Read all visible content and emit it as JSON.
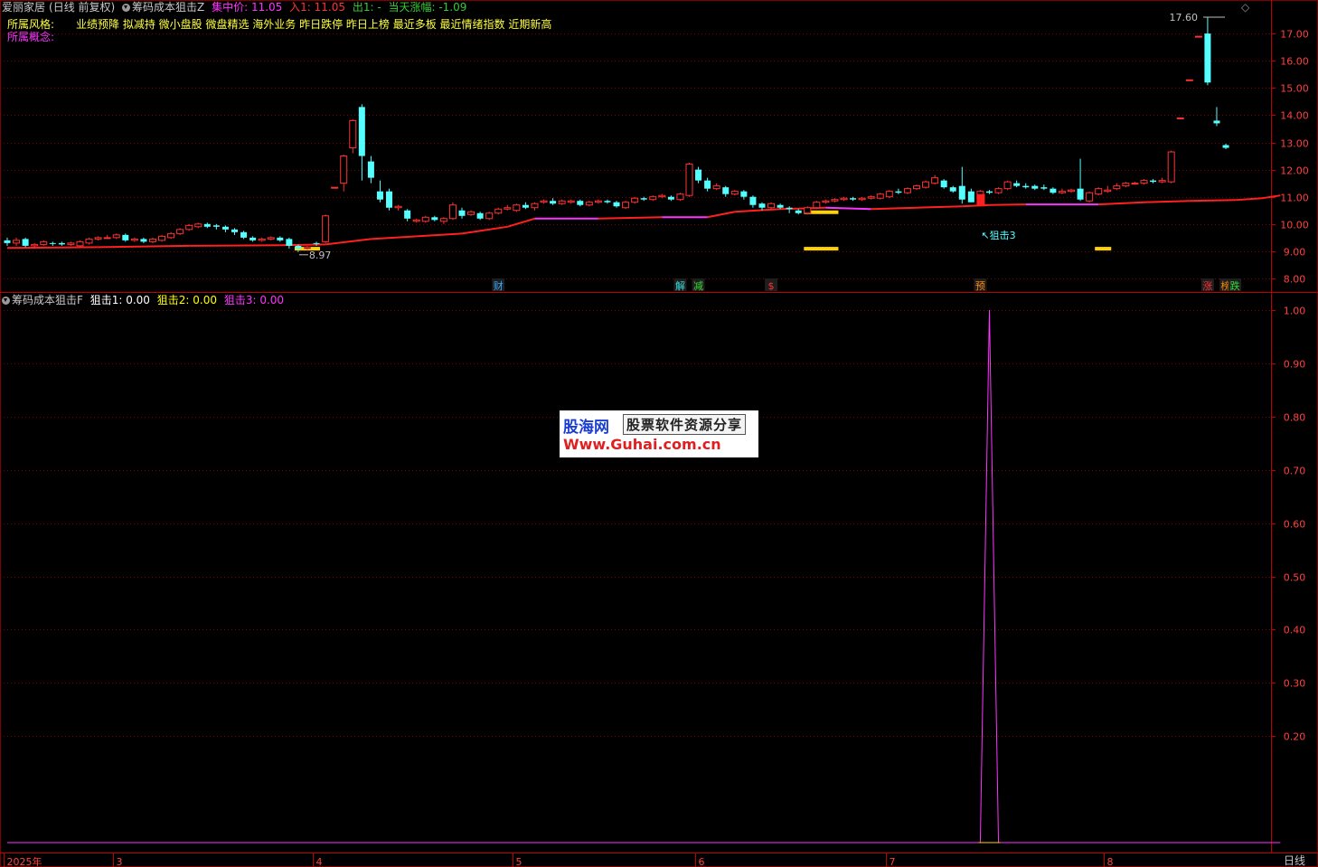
{
  "header": {
    "stock": "爱丽家居",
    "period": "(日线 前复权)",
    "indicator_main": "筹码成本狙击Z",
    "ind_items": [
      {
        "label": "集中价: 11.05",
        "color": "#ff33ff"
      },
      {
        "label": "入1: 11.05",
        "color": "#ff3333"
      },
      {
        "label": "出1: -",
        "color": "#33cc33"
      },
      {
        "label": "当天涨幅: -1.09",
        "color": "#33cc33"
      }
    ],
    "style_label": "所属风格:",
    "style_tags": "业绩预降 拟减持 微小盘股 微盘精选 海外业务 昨日跌停 昨日上榜 最近多板 最近情绪指数 近期新高",
    "concept_label": "所属概念:",
    "diamond": "◇"
  },
  "sub_header": {
    "indicator_sub": "筹码成本狙击F",
    "items": [
      {
        "label": "狙击1: 0.00",
        "color": "#ffffff"
      },
      {
        "label": "狙击2: 0.00",
        "color": "#ffff00"
      },
      {
        "label": "狙击3: 0.00",
        "color": "#ff33ff"
      }
    ]
  },
  "watermark": {
    "brand": "股海网",
    "slogan": "股票软件资源分享",
    "url": "Www.Guhai.com.cn"
  },
  "annotations": {
    "high_label": "17.60",
    "low_label": "8.97",
    "signal_label": "狙击3",
    "markers": [
      {
        "text": "财",
        "color": "#33aaff",
        "index": 54
      },
      {
        "text": "解",
        "color": "#33dddd",
        "index": 74
      },
      {
        "text": "减",
        "color": "#33dd33",
        "index": 76
      },
      {
        "text": "$",
        "color": "#ff3333",
        "index": 84
      },
      {
        "text": "预",
        "color": "#ff8800",
        "index": 107
      },
      {
        "text": "涨",
        "color": "#ff3333",
        "index": 132
      },
      {
        "text": "榜",
        "color": "#ff8800",
        "index": 134
      },
      {
        "text": "跌",
        "color": "#33dd33",
        "index": 135
      }
    ]
  },
  "footer": {
    "period_label": "日线"
  },
  "colors": {
    "up": "#ff3232",
    "down": "#54ffff",
    "cost_line_red": "#ff2020",
    "cost_line_magenta": "#ff33ff",
    "grid": "#800000",
    "axis_text": "#ff4040",
    "signal": "#ff33ff",
    "zone_yellow": "#ffd200"
  },
  "chart_data": [
    {
      "type": "candlestick",
      "title": "筹码成本狙击Z",
      "y_ticks": [
        "8.00",
        "9.00",
        "10.00",
        "11.00",
        "12.00",
        "13.00",
        "14.00",
        "15.00",
        "16.00",
        "17.00"
      ],
      "ylim": [
        7.7,
        17.9
      ],
      "x_ticks": [
        {
          "label": "2025年",
          "index": 0
        },
        {
          "label": "3",
          "index": 12
        },
        {
          "label": "4",
          "index": 34
        },
        {
          "label": "5",
          "index": 56
        },
        {
          "label": "6",
          "index": 76
        },
        {
          "label": "7",
          "index": 97
        },
        {
          "label": "8",
          "index": 121
        }
      ],
      "candles": [
        [
          9.4,
          9.3,
          9.5,
          9.2
        ],
        [
          9.3,
          9.4,
          9.5,
          9.2
        ],
        [
          9.45,
          9.2,
          9.5,
          9.15
        ],
        [
          9.2,
          9.25,
          9.3,
          9.1
        ],
        [
          9.25,
          9.35,
          9.4,
          9.2
        ],
        [
          9.3,
          9.28,
          9.35,
          9.2
        ],
        [
          9.3,
          9.25,
          9.35,
          9.2
        ],
        [
          9.25,
          9.3,
          9.35,
          9.2
        ],
        [
          9.2,
          9.35,
          9.4,
          9.15
        ],
        [
          9.3,
          9.45,
          9.5,
          9.25
        ],
        [
          9.45,
          9.5,
          9.55,
          9.4
        ],
        [
          9.5,
          9.5,
          9.6,
          9.45
        ],
        [
          9.5,
          9.6,
          9.65,
          9.45
        ],
        [
          9.6,
          9.4,
          9.65,
          9.35
        ],
        [
          9.4,
          9.45,
          9.5,
          9.35
        ],
        [
          9.45,
          9.35,
          9.5,
          9.3
        ],
        [
          9.35,
          9.45,
          9.5,
          9.3
        ],
        [
          9.4,
          9.55,
          9.6,
          9.35
        ],
        [
          9.5,
          9.65,
          9.7,
          9.45
        ],
        [
          9.65,
          9.8,
          9.85,
          9.6
        ],
        [
          9.8,
          9.95,
          10.0,
          9.75
        ],
        [
          9.9,
          10.0,
          10.05,
          9.85
        ],
        [
          10.0,
          9.9,
          10.05,
          9.85
        ],
        [
          9.95,
          9.9,
          10.0,
          9.8
        ],
        [
          9.9,
          9.8,
          9.95,
          9.7
        ],
        [
          9.8,
          9.7,
          9.85,
          9.6
        ],
        [
          9.7,
          9.5,
          9.75,
          9.45
        ],
        [
          9.5,
          9.4,
          9.55,
          9.35
        ],
        [
          9.4,
          9.45,
          9.5,
          9.35
        ],
        [
          9.45,
          9.5,
          9.55,
          9.4
        ],
        [
          9.5,
          9.4,
          9.55,
          9.35
        ],
        [
          9.45,
          9.2,
          9.5,
          9.1
        ],
        [
          9.2,
          9.1,
          9.25,
          8.97
        ],
        [
          9.1,
          9.15,
          9.2,
          9.05
        ],
        [
          9.3,
          9.28,
          9.35,
          9.2
        ],
        [
          9.35,
          10.3,
          10.35,
          9.3
        ],
        [
          11.35,
          11.35,
          11.35,
          11.35
        ],
        [
          11.5,
          12.5,
          12.55,
          11.2
        ],
        [
          12.8,
          13.8,
          13.85,
          12.6
        ],
        [
          14.3,
          12.5,
          14.4,
          11.6
        ],
        [
          12.3,
          11.7,
          12.5,
          11.5
        ],
        [
          11.2,
          10.9,
          11.6,
          10.8
        ],
        [
          11.2,
          10.6,
          11.3,
          10.5
        ],
        [
          10.6,
          10.65,
          10.7,
          10.5
        ],
        [
          10.5,
          10.2,
          10.55,
          10.1
        ],
        [
          10.1,
          10.15,
          10.2,
          10.05
        ],
        [
          10.1,
          10.25,
          10.3,
          10.05
        ],
        [
          10.25,
          10.15,
          10.3,
          10.1
        ],
        [
          10.1,
          10.2,
          10.25,
          10.0
        ],
        [
          10.2,
          10.7,
          10.8,
          10.15
        ],
        [
          10.5,
          10.3,
          10.6,
          10.2
        ],
        [
          10.35,
          10.45,
          10.5,
          10.3
        ],
        [
          10.4,
          10.2,
          10.45,
          10.15
        ],
        [
          10.2,
          10.4,
          10.45,
          10.15
        ],
        [
          10.4,
          10.55,
          10.6,
          10.35
        ],
        [
          10.55,
          10.6,
          10.7,
          10.5
        ],
        [
          10.5,
          10.7,
          10.75,
          10.45
        ],
        [
          10.7,
          10.6,
          10.8,
          10.55
        ],
        [
          10.6,
          10.75,
          10.8,
          10.5
        ],
        [
          10.8,
          10.85,
          10.9,
          10.75
        ],
        [
          10.85,
          10.75,
          10.95,
          10.7
        ],
        [
          10.75,
          10.85,
          10.9,
          10.7
        ],
        [
          10.8,
          10.85,
          10.9,
          10.75
        ],
        [
          10.85,
          10.7,
          10.9,
          10.65
        ],
        [
          10.7,
          10.8,
          10.85,
          10.65
        ],
        [
          10.8,
          10.85,
          10.9,
          10.75
        ],
        [
          10.85,
          10.8,
          10.9,
          10.75
        ],
        [
          10.8,
          10.65,
          10.85,
          10.6
        ],
        [
          10.6,
          10.8,
          10.85,
          10.55
        ],
        [
          10.8,
          10.95,
          11.0,
          10.75
        ],
        [
          10.95,
          10.9,
          11.0,
          10.85
        ],
        [
          10.9,
          11.0,
          11.05,
          10.85
        ],
        [
          11.0,
          11.05,
          11.1,
          10.95
        ],
        [
          11.0,
          10.9,
          11.05,
          10.85
        ],
        [
          10.9,
          11.1,
          11.15,
          10.85
        ],
        [
          11.05,
          12.2,
          12.25,
          11.0
        ],
        [
          12.0,
          11.6,
          12.1,
          11.5
        ],
        [
          11.6,
          11.3,
          11.7,
          11.2
        ],
        [
          11.3,
          11.4,
          11.5,
          11.25
        ],
        [
          11.35,
          11.1,
          11.4,
          11.0
        ],
        [
          11.1,
          11.2,
          11.25,
          11.05
        ],
        [
          11.2,
          11.0,
          11.25,
          10.9
        ],
        [
          11.0,
          10.7,
          11.05,
          10.6
        ],
        [
          10.75,
          10.6,
          10.8,
          10.5
        ],
        [
          10.6,
          10.75,
          10.8,
          10.55
        ],
        [
          10.7,
          10.6,
          10.75,
          10.55
        ],
        [
          10.6,
          10.55,
          10.65,
          10.4
        ],
        [
          10.5,
          10.4,
          10.55,
          10.35
        ],
        [
          10.4,
          10.6,
          10.65,
          10.35
        ],
        [
          10.6,
          10.8,
          10.85,
          10.55
        ],
        [
          10.8,
          10.85,
          10.9,
          10.75
        ],
        [
          10.85,
          10.9,
          10.95,
          10.8
        ],
        [
          10.9,
          10.95,
          11.0,
          10.85
        ],
        [
          10.95,
          10.9,
          11.0,
          10.85
        ],
        [
          10.9,
          10.95,
          11.0,
          10.85
        ],
        [
          10.95,
          11.0,
          11.05,
          10.9
        ],
        [
          10.95,
          11.1,
          11.15,
          10.9
        ],
        [
          11.0,
          11.2,
          11.25,
          10.95
        ],
        [
          11.2,
          11.15,
          11.3,
          11.1
        ],
        [
          11.15,
          11.3,
          11.35,
          11.1
        ],
        [
          11.3,
          11.4,
          11.45,
          11.25
        ],
        [
          11.35,
          11.55,
          11.6,
          11.3
        ],
        [
          11.5,
          11.7,
          11.8,
          11.45
        ],
        [
          11.6,
          11.35,
          11.65,
          11.3
        ],
        [
          11.35,
          11.2,
          11.4,
          11.15
        ],
        [
          11.4,
          10.9,
          12.1,
          10.75
        ],
        [
          11.2,
          10.8,
          11.3,
          10.8
        ],
        [
          11.0,
          11.2,
          11.25,
          10.95
        ],
        [
          11.2,
          11.15,
          11.25,
          11.1
        ],
        [
          11.15,
          11.3,
          11.35,
          11.1
        ],
        [
          11.3,
          11.55,
          11.6,
          11.25
        ],
        [
          11.5,
          11.4,
          11.6,
          11.35
        ],
        [
          11.4,
          11.35,
          11.5,
          11.3
        ],
        [
          11.4,
          11.3,
          11.45,
          11.25
        ],
        [
          11.35,
          11.3,
          11.45,
          11.25
        ],
        [
          11.3,
          11.15,
          11.35,
          11.1
        ],
        [
          11.15,
          11.2,
          11.3,
          11.1
        ],
        [
          11.2,
          11.25,
          11.3,
          11.15
        ],
        [
          11.3,
          10.9,
          12.4,
          10.85
        ],
        [
          10.85,
          11.15,
          11.2,
          10.8
        ],
        [
          11.1,
          11.3,
          11.35,
          11.05
        ],
        [
          11.2,
          11.25,
          11.4,
          11.15
        ],
        [
          11.3,
          11.4,
          11.5,
          11.25
        ],
        [
          11.4,
          11.5,
          11.55,
          11.35
        ],
        [
          11.5,
          11.5,
          11.55,
          11.45
        ],
        [
          11.5,
          11.6,
          11.65,
          11.45
        ],
        [
          11.6,
          11.55,
          11.65,
          11.5
        ],
        [
          11.55,
          11.6,
          11.7,
          11.5
        ],
        [
          11.55,
          12.65,
          12.7,
          11.5
        ],
        [
          13.9,
          13.9,
          13.9,
          13.9
        ],
        [
          15.3,
          15.3,
          15.3,
          15.3
        ],
        [
          16.9,
          16.9,
          16.9,
          16.9
        ],
        [
          17.0,
          15.2,
          17.6,
          15.1
        ],
        [
          13.8,
          13.7,
          14.3,
          13.6
        ],
        [
          12.9,
          12.8,
          12.95,
          12.75
        ]
      ],
      "cost_line": [
        [
          0,
          9.12
        ],
        [
          10,
          9.15
        ],
        [
          20,
          9.2
        ],
        [
          30,
          9.22
        ],
        [
          35,
          9.25
        ],
        [
          40,
          9.45
        ],
        [
          45,
          9.55
        ],
        [
          50,
          9.65
        ],
        [
          55,
          9.9
        ],
        [
          58,
          10.2
        ],
        [
          65,
          10.2
        ],
        [
          72,
          10.25
        ],
        [
          77,
          10.25
        ],
        [
          80,
          10.45
        ],
        [
          85,
          10.55
        ],
        [
          90,
          10.6
        ],
        [
          95,
          10.55
        ],
        [
          100,
          10.6
        ],
        [
          105,
          10.65
        ],
        [
          108,
          10.7
        ],
        [
          112,
          10.72
        ],
        [
          120,
          10.72
        ],
        [
          125,
          10.8
        ],
        [
          130,
          10.85
        ],
        [
          135,
          10.88
        ],
        [
          138,
          10.95
        ],
        [
          140,
          11.05
        ]
      ]
    },
    {
      "type": "line",
      "title": "筹码成本狙击F",
      "series": [
        {
          "name": "狙击3",
          "color": "#ff33ff",
          "points": [
            [
              0,
              0
            ],
            [
              107,
              0
            ],
            [
              108,
              1.0
            ],
            [
              109,
              0
            ],
            [
              140,
              0
            ]
          ]
        }
      ],
      "y_ticks": [
        "0.20",
        "0.30",
        "0.40",
        "0.50",
        "0.60",
        "0.70",
        "0.80",
        "0.90",
        "1.00"
      ],
      "ylim": [
        -0.03,
        1.03
      ]
    }
  ]
}
